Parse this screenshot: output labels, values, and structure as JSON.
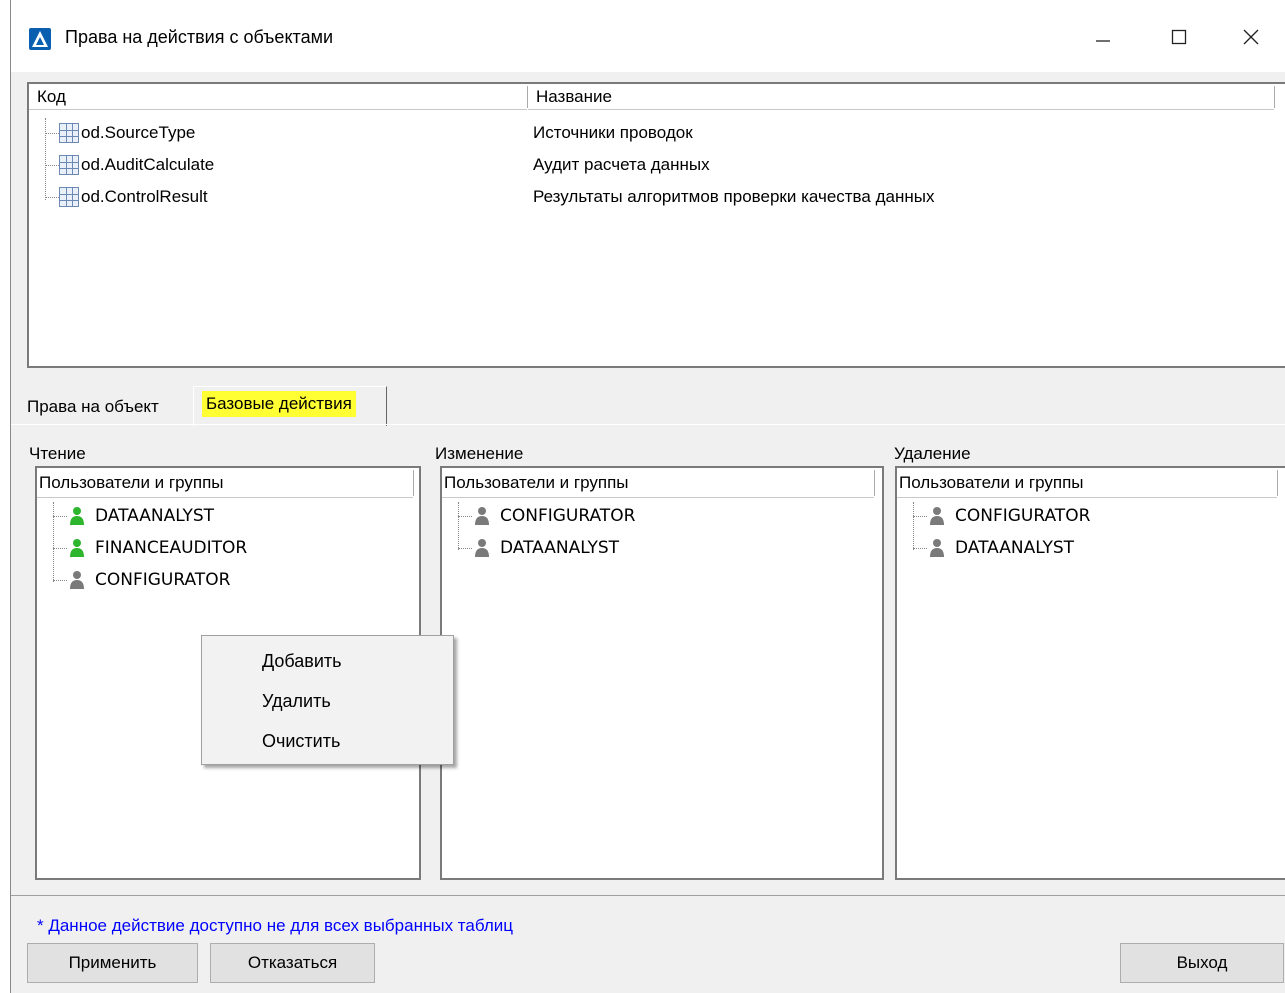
{
  "window": {
    "title": "Права на действия с объектами"
  },
  "table": {
    "columns": [
      "Код",
      "Название"
    ],
    "rows": [
      {
        "code": "od.SourceType",
        "name": "Источники проводок"
      },
      {
        "code": "od.AuditCalculate",
        "name": "Аудит расчета данных"
      },
      {
        "code": "od.ControlResult",
        "name": "Результаты алгоритмов проверки качества данных"
      }
    ]
  },
  "tabs": [
    {
      "label": "Права на объект"
    },
    {
      "label": "Базовые действия"
    }
  ],
  "groups": [
    {
      "label": "Чтение",
      "header": "Пользователи и группы",
      "users": [
        {
          "name": "DATAANALYST",
          "icon": "user-green-icon"
        },
        {
          "name": "FINANCEAUDITOR",
          "icon": "user-green-icon"
        },
        {
          "name": "CONFIGURATOR",
          "icon": "user-gray-icon"
        }
      ]
    },
    {
      "label": "Изменение",
      "header": "Пользователи и группы",
      "users": [
        {
          "name": "CONFIGURATOR",
          "icon": "user-gray-icon"
        },
        {
          "name": "DATAANALYST",
          "icon": "user-gray-icon"
        }
      ]
    },
    {
      "label": "Удаление",
      "header": "Пользователи и группы",
      "users": [
        {
          "name": "CONFIGURATOR",
          "icon": "user-gray-icon"
        },
        {
          "name": "DATAANALYST",
          "icon": "user-gray-icon"
        }
      ]
    }
  ],
  "context_menu": [
    "Добавить",
    "Удалить",
    "Очистить"
  ],
  "footnote": "* Данное действие доступно не для всех выбранных таблиц",
  "buttons": {
    "apply": "Применить",
    "cancel": "Отказаться",
    "exit": "Выход"
  },
  "colors": {
    "highlight": "#ffff33",
    "footnote": "#0000ff",
    "user_green": "#2db52d",
    "user_gray": "#7a7a7a"
  }
}
